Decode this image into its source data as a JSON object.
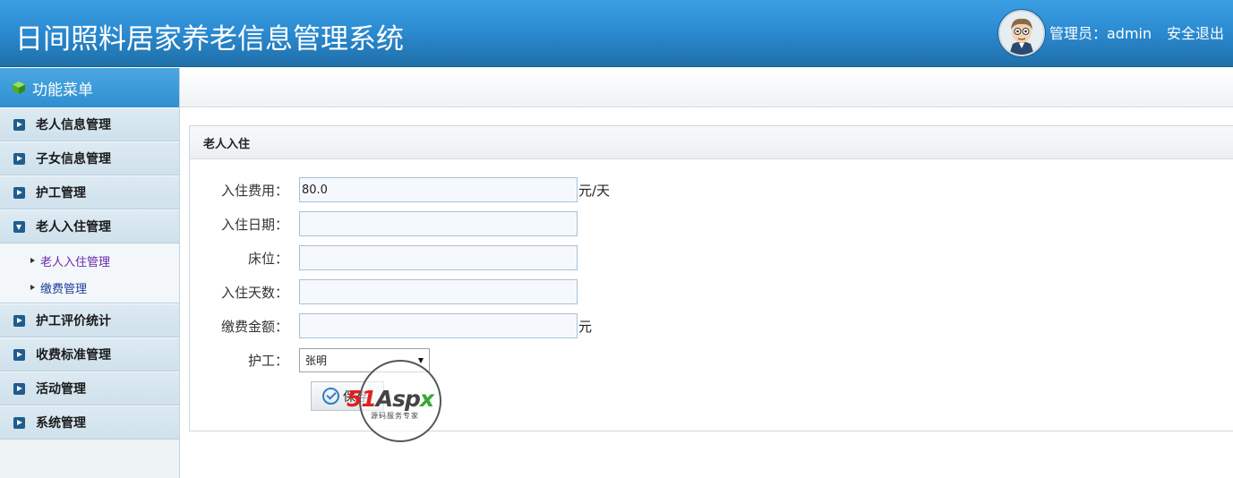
{
  "header": {
    "title": "日间照料居家养老信息管理系统",
    "user_label": "管理员：admin",
    "logout_label": "安全退出"
  },
  "sidebar": {
    "heading": "功能菜单",
    "items": [
      {
        "label": "老人信息管理"
      },
      {
        "label": "子女信息管理"
      },
      {
        "label": "护工管理"
      },
      {
        "label": "老人入住管理"
      },
      {
        "label": "护工评价统计"
      },
      {
        "label": "收费标准管理"
      },
      {
        "label": "活动管理"
      },
      {
        "label": "系统管理"
      }
    ],
    "subitems": [
      {
        "label": "老人入住管理"
      },
      {
        "label": "缴费管理"
      }
    ]
  },
  "panel": {
    "title": "老人入住"
  },
  "form": {
    "fee_label": "入住费用：",
    "fee_value": "80.0",
    "fee_unit": "元/天",
    "date_label": "入住日期：",
    "date_value": "",
    "bed_label": "床位：",
    "bed_value": "",
    "days_label": "入住天数：",
    "days_value": "",
    "amount_label": "缴费金额：",
    "amount_value": "",
    "amount_unit": "元",
    "caregiver_label": "护工：",
    "caregiver_value": "张明",
    "save_label": "保存"
  },
  "watermark": {
    "part1": "51",
    "part2": "Asp",
    "part3": "x",
    "sub": "源码服务专家"
  },
  "colors": {
    "header_blue": "#2c8cd2",
    "menu_icon": "#1f5d8f",
    "active_sub": "#6a2aa8"
  }
}
